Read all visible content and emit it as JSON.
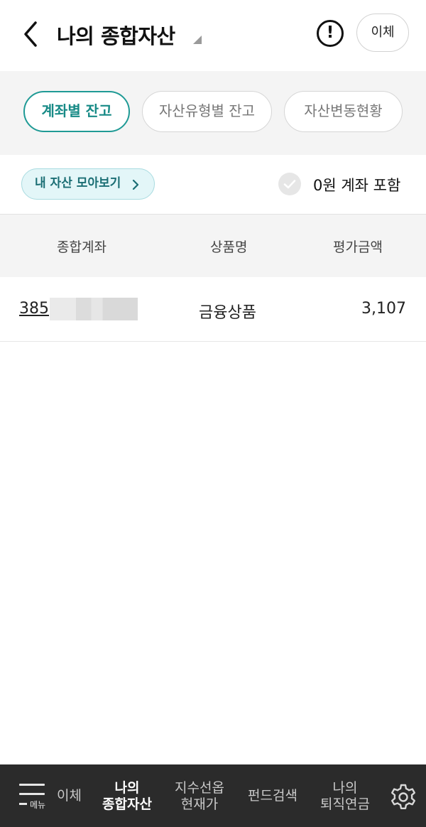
{
  "header": {
    "title": "나의 종합자산",
    "info_label": "!",
    "transfer_label": "이체"
  },
  "tabs": [
    {
      "label": "계좌별 잔고",
      "active": true
    },
    {
      "label": "자산유형별 잔고",
      "active": false
    },
    {
      "label": "자산변동현황",
      "active": false
    }
  ],
  "filter": {
    "my_assets_label": "내 자산 모아보기",
    "zero_account_label": "0원 계좌 포함",
    "zero_account_checked": false
  },
  "table": {
    "headers": [
      "종합계좌",
      "상품명",
      "평가금액"
    ],
    "rows": [
      {
        "account": "385",
        "product": "금융상품",
        "amount": "3,107"
      }
    ]
  },
  "bottom_nav": {
    "menu_label": "메뉴",
    "items": [
      {
        "line1": "이체",
        "line2": ""
      },
      {
        "line1": "나의",
        "line2": "종합자산"
      },
      {
        "line1": "지수선옵",
        "line2": "현재가"
      },
      {
        "line1": "펀드검색",
        "line2": ""
      },
      {
        "line1": "나의",
        "line2": "퇴직연금"
      }
    ]
  },
  "colors": {
    "accent": "#1f9a95",
    "nav_background": "#2b2b2b",
    "section_background": "#f4f4f4"
  }
}
